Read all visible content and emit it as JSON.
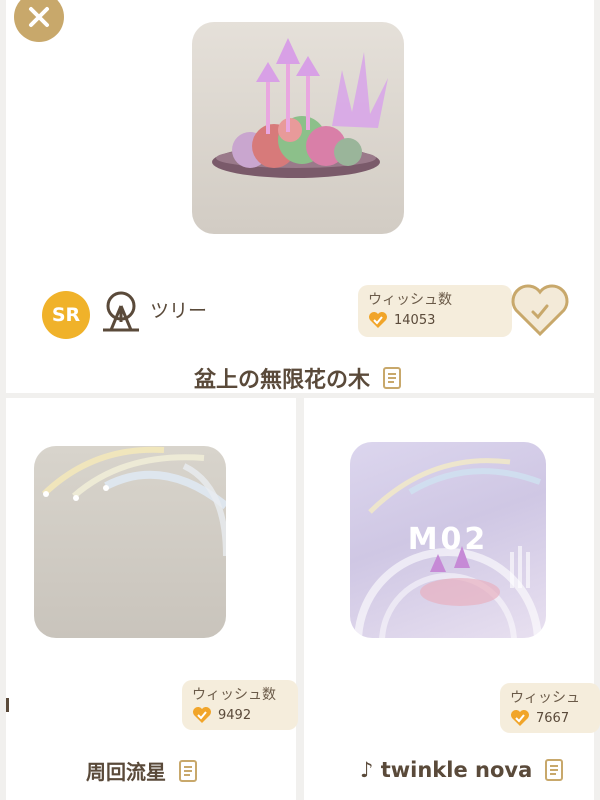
{
  "featured": {
    "rarity": "SR",
    "category": "ツリー",
    "wish_label": "ウィッシュ数",
    "wish_count": "14053",
    "title": "盆上の無限花の木"
  },
  "items": [
    {
      "title": "周回流星",
      "wish_label": "ウィッシュ数",
      "wish_count": "9492"
    },
    {
      "title": "♪ twinkle nova",
      "wish_label": "ウィッシュ",
      "wish_count": "7667",
      "code": "M02"
    }
  ],
  "colors": {
    "accent_gold": "#c8a86b",
    "sr_badge": "#f0b22a",
    "heart_orange": "#f1a52a",
    "wish_bg": "#f5eddc",
    "text_brown": "#5a4a3a"
  },
  "icons": [
    "close-icon",
    "tree-icon",
    "heart-icon",
    "document-icon",
    "music-note-icon"
  ]
}
